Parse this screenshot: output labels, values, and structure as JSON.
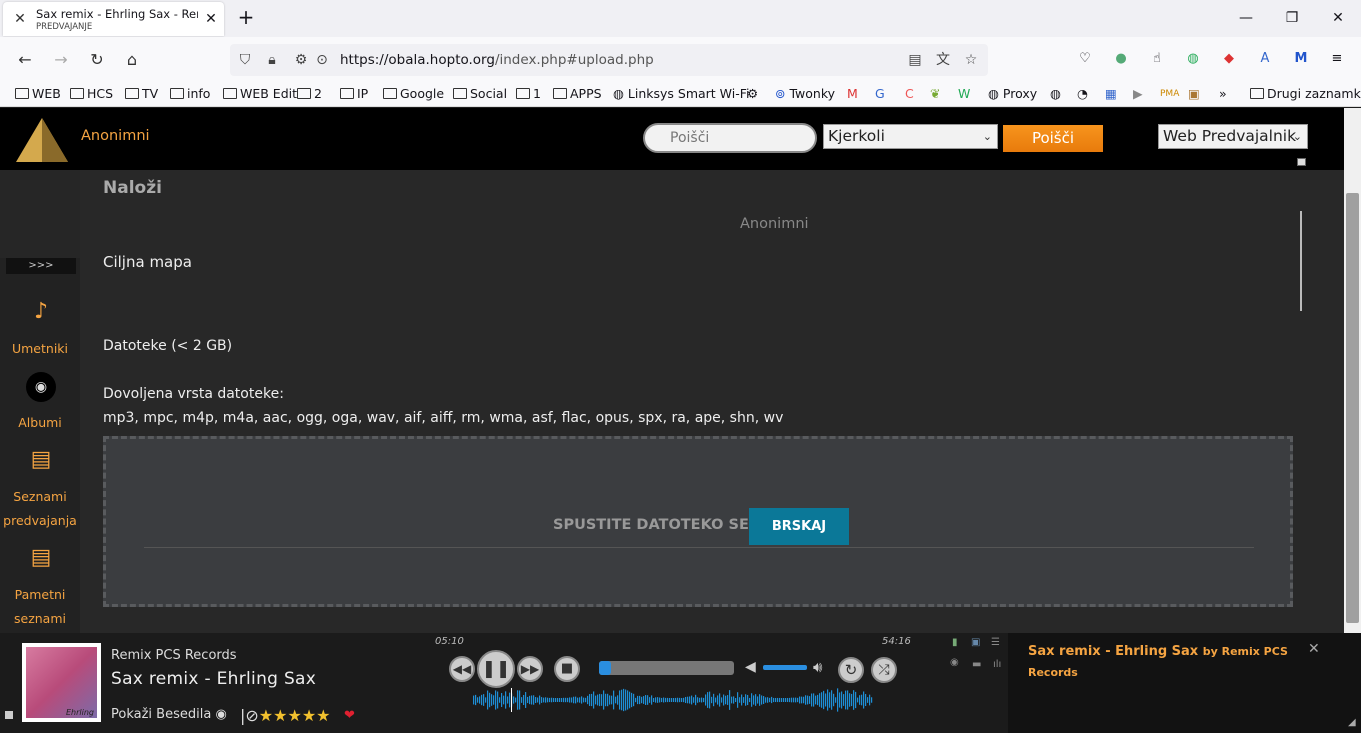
{
  "browser": {
    "tab_title": "Sax remix - Ehrling Sax - Remix",
    "tab_subtitle": "PREDVAJANJE",
    "url_host": "https://obala.hopto.org",
    "url_path": "/index.php#upload.php",
    "bookmarks": [
      "WEB",
      "HCS",
      "TV",
      "info",
      "WEB Edit",
      "2",
      "IP",
      "Google",
      "Social",
      "1",
      "APPS",
      "Linksys Smart Wi-Fi",
      "Twonky",
      "Proxy",
      "Drugi zaznamki"
    ]
  },
  "header": {
    "user": "Anonimni",
    "search_placeholder": "Poišči",
    "scope": "Kjerkoli",
    "search_button": "Poišči",
    "player_select": "Web Predvajalnik"
  },
  "sidebar": {
    "toggle": ">>>",
    "items": [
      {
        "label": "Umetniki",
        "icon": "artist-icon"
      },
      {
        "label": "Albumi",
        "icon": "album-icon"
      },
      {
        "label": "Seznami predvajanja",
        "icon": "playlist-icon"
      },
      {
        "label": "Pametni seznami",
        "icon": "smart-playlist-icon"
      }
    ]
  },
  "upload": {
    "title": "Naloži",
    "owner": "Anonimni",
    "target_label": "Ciljna mapa",
    "files_label": "Datoteke (< 2 GB)",
    "allowed_label": "Dovoljena vrsta datoteke:",
    "allowed_types": "mp3, mpc, m4p, m4a, aac, ogg, oga, wav, aif, aiff, rm, wma, asf, flac, opus, spx, ra, ape, shn, wv",
    "drop_text": "SPUSTITE DATOTEKO SEM",
    "browse_label": "BRSKAJ"
  },
  "player": {
    "artist": "Remix PCS Records",
    "song": "Sax remix - Ehrling Sax",
    "cover_text": "Ehrling",
    "lyrics_label": "Pokaži Besedila",
    "rating": "★★★★★",
    "elapsed": "05:10",
    "total": "54:16",
    "progress_fraction": 0.09,
    "volume_fraction": 0.95
  },
  "notification": {
    "title": "Sax remix - Ehrling Sax",
    "by": "by Remix PCS Records"
  }
}
